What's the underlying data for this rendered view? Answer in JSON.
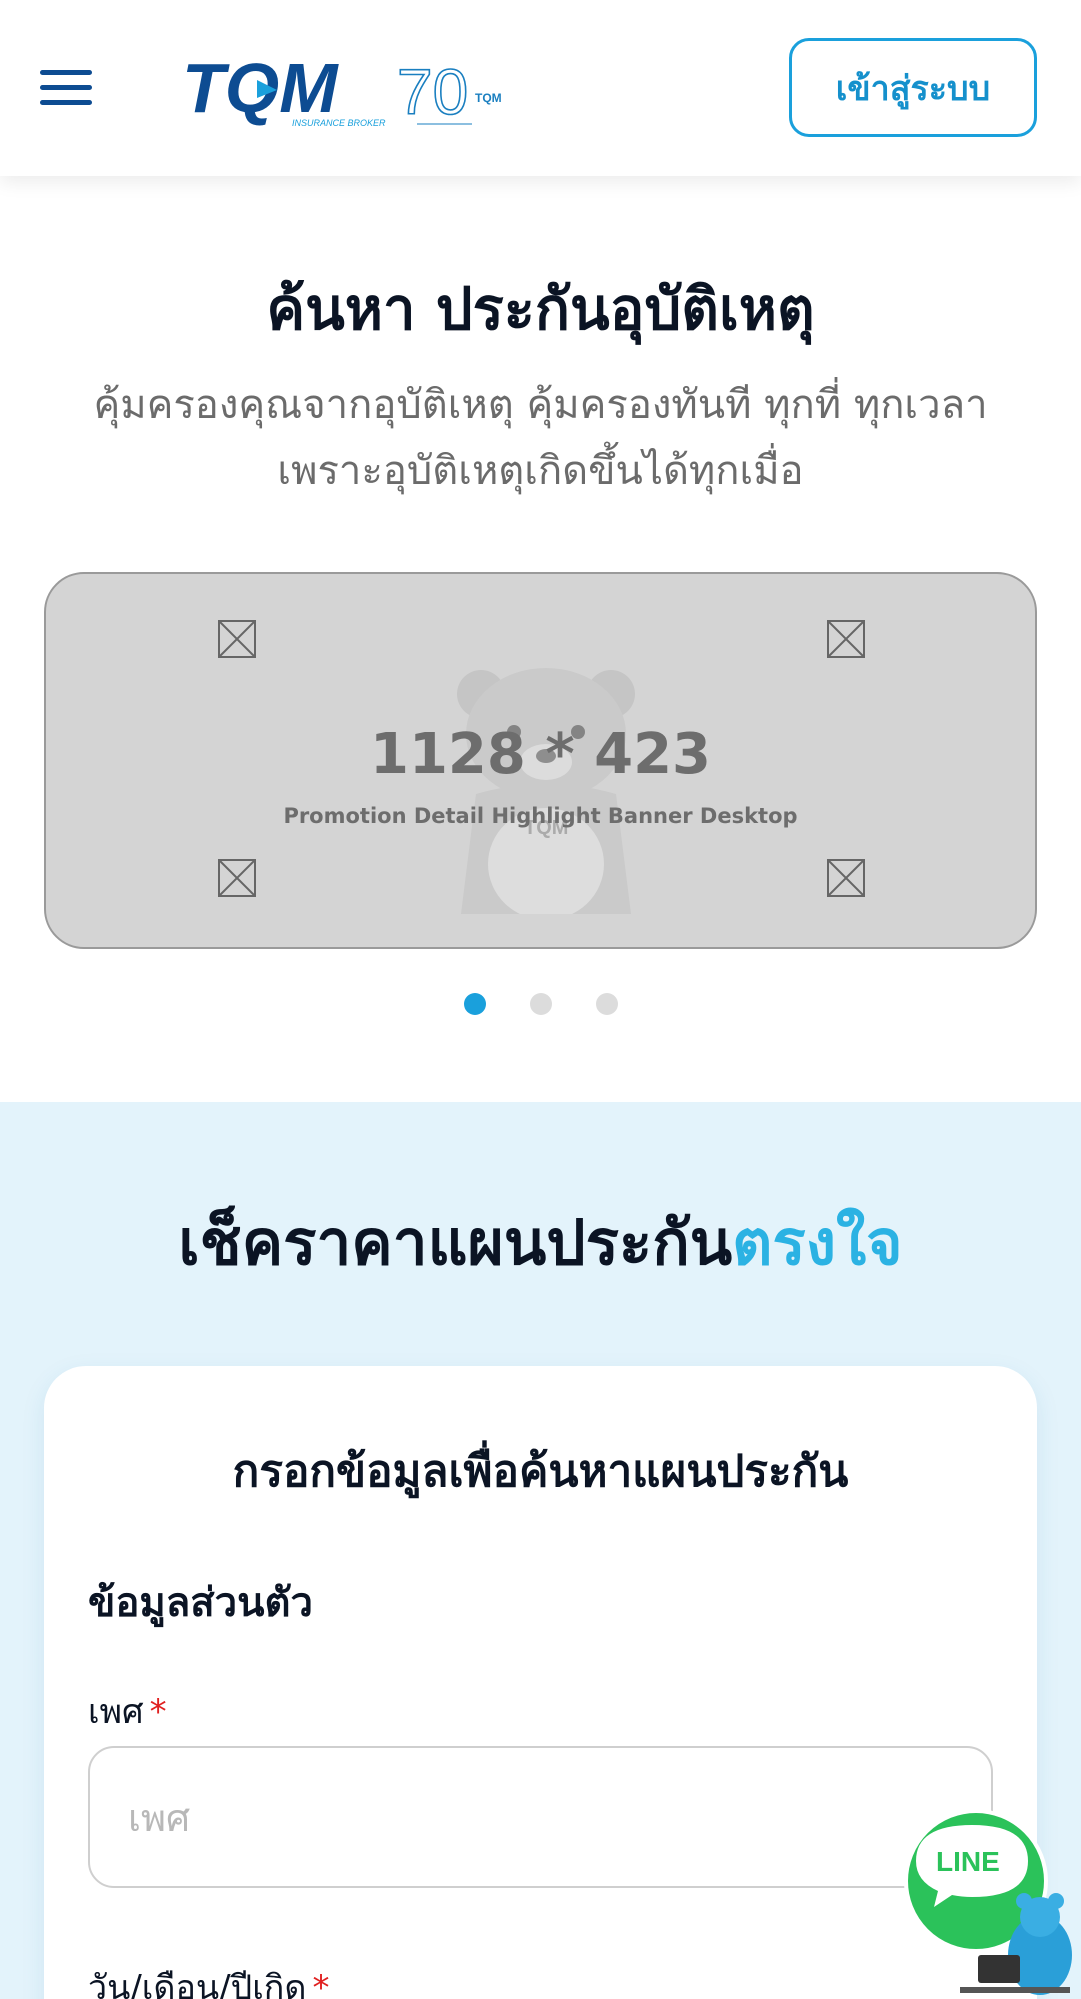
{
  "header": {
    "logo_text": "TQM",
    "logo_sub": "INSURANCE BROKER",
    "anniversary_text": "70",
    "anniversary_brand": "TQM",
    "login_label": "เข้าสู่ระบบ",
    "menu_icon": "hamburger-icon"
  },
  "hero": {
    "title": "ค้นหา ประกันอุบัติเหตุ",
    "subtitle_line1": "คุ้มครองคุณจากอุบัติเหตุ คุ้มครองทันที ทุกที่ ทุกเวลา",
    "subtitle_line2": "เพราะอุบัติเหตุเกิดขึ้นได้ทุกเมื่อ"
  },
  "banner": {
    "size_text": "1128 * 423",
    "caption": "Promotion Detail Highlight Banner Desktop",
    "watermark": "TQM",
    "slides": 3,
    "active_slide": 1
  },
  "quote": {
    "title_main": "เช็คราคาแผนประกัน",
    "title_accent": "ตรงใจ",
    "card_title": "กรอกข้อมูลเพื่อค้นหาแผนประกัน",
    "section_label": "ข้อมูลส่วนตัว",
    "gender_label": "เพศ",
    "gender_placeholder": "เพศ",
    "dob_label": "วัน/เดือน/ปีเกิด",
    "required_mark": "*"
  },
  "line_chat": {
    "label": "LINE"
  },
  "colors": {
    "brand_blue": "#0d4c92",
    "accent_blue": "#1aa0dc",
    "section_bg": "#e3f3fb",
    "line_green": "#2bc25a",
    "required_red": "#e02020"
  }
}
